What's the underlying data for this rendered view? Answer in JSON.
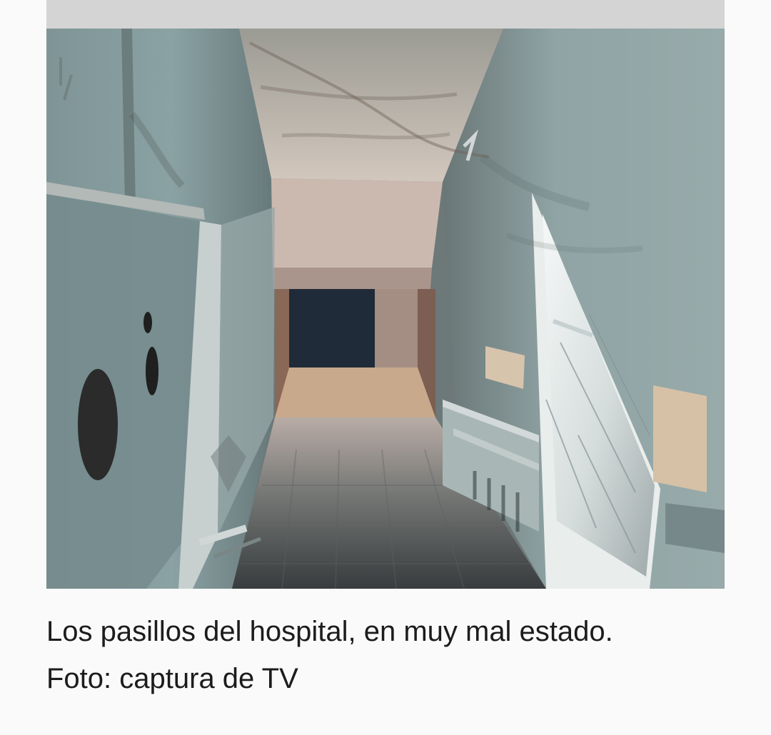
{
  "article_image": {
    "caption": "Los pasillos del hospital, en muy mal estado.",
    "credit": "Foto: captura de TV"
  }
}
